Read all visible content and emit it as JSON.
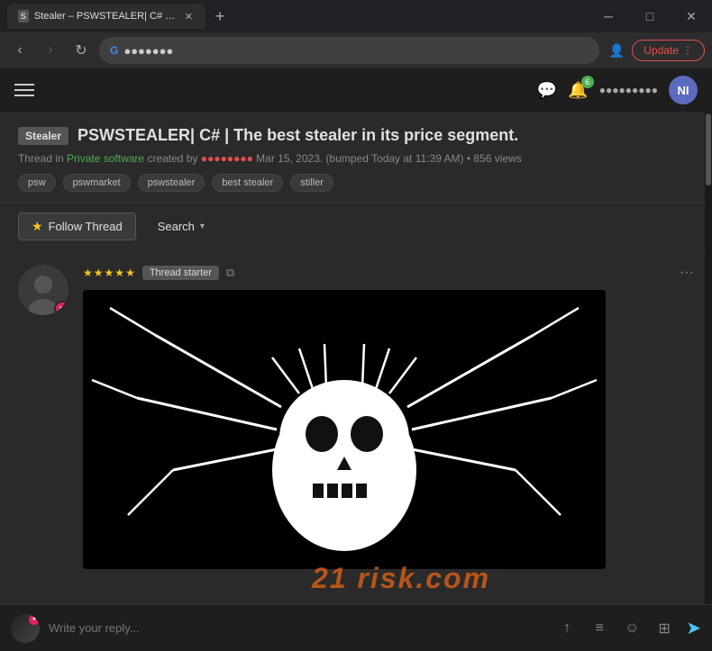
{
  "browser": {
    "tab_title": "Stealer – PSWSTEALER| C# | The b...",
    "tab_favicon": "S",
    "address_masked": "●●●●●●●",
    "update_label": "Update",
    "win_minimize": "─",
    "win_maximize": "□",
    "win_close": "✕"
  },
  "header": {
    "notification_count": "6",
    "username_masked": "●●●●●●●●●",
    "avatar_initials": "NI"
  },
  "thread": {
    "badge_label": "Stealer",
    "title": "PSWSTEALER| C# | The best stealer in its price segment.",
    "meta_prefix": "Thread in",
    "meta_link": "Private software",
    "meta_created_by": "created by",
    "meta_author_masked": "●●●●●●●●",
    "meta_date": "Mar 15, 2023.",
    "meta_bumped": "(bumped Today at 11:39 AM)",
    "meta_views": "856 views",
    "tags": [
      "psw",
      "pswmarket",
      "pswstealer",
      "best stealer",
      "stiller"
    ]
  },
  "actions": {
    "follow_label": "Follow Thread",
    "search_label": "Search",
    "search_chevron": "▾"
  },
  "post": {
    "stars_count": 5,
    "thread_starter_label": "Thread starter",
    "options_icon": "···"
  },
  "reply_bar": {
    "placeholder": "Write your reply...",
    "upload_icon": "↑",
    "list_icon": "≡",
    "emoji_icon": "☺",
    "image_icon": "⊞",
    "send_icon": "➤"
  },
  "watermark": {
    "text": "21 risk.com"
  }
}
